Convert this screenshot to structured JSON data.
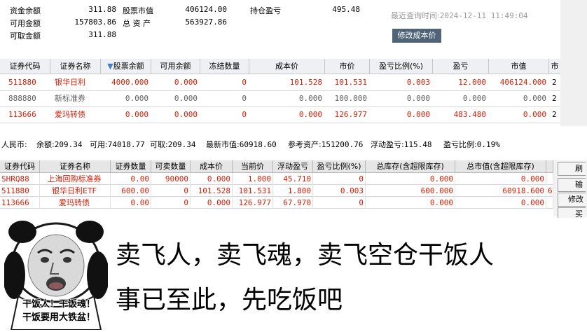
{
  "summary": {
    "fund_balance_label": "资金余额",
    "fund_balance": "311.88",
    "available_label": "可用金额",
    "available": "157803.86",
    "withdrawable_label": "可取金额",
    "withdrawable": "311.88",
    "stock_value_label": "股票市值",
    "stock_value": "406124.00",
    "total_assets_label": "总 资 产",
    "total_assets": "563927.86",
    "position_pl_label": "持仓盈亏",
    "position_pl": "495.48",
    "query_time_label": "最近查询时间:",
    "query_time": "2024-12-11 11:49:04",
    "modify_cost_button": "修改成本价"
  },
  "upper_table": {
    "sort_arrow": "▼",
    "headers": [
      "证券代码",
      "证券名称",
      "股票余额",
      "可用余额",
      "冻结数量",
      "成本价",
      "市价",
      "盈亏比例(%)",
      "盈亏",
      "市值",
      "市"
    ],
    "rows": [
      {
        "code": "511880",
        "name": "银华日利",
        "balance": "4000.000",
        "available": "0.000",
        "frozen": "0",
        "cost": "101.528",
        "price": "101.531",
        "pl_ratio": "0.003",
        "pl": "12.000",
        "value": "406124.000",
        "mkt": "2",
        "color": "red"
      },
      {
        "code": "888880",
        "name": "新标准券",
        "balance": "0.000",
        "available": "0.000",
        "frozen": "0",
        "cost": "0.000",
        "price": "100.000",
        "pl_ratio": "0.000",
        "pl": "0.000",
        "value": "0.000",
        "mkt": "2",
        "color": "gray"
      },
      {
        "code": "113666",
        "name": "爱玛转债",
        "balance": "0.000",
        "available": "0.000",
        "frozen": "0",
        "cost": "0.000",
        "price": "126.977",
        "pl_ratio": "0.000",
        "pl": "483.480",
        "value": "0.000",
        "mkt": "2",
        "color": "red"
      }
    ]
  },
  "rmb_bar": {
    "currency": "人民币:",
    "balance_label": "余额:",
    "balance": "209.34",
    "available_label": "可用:",
    "available": "74018.77",
    "withdrawable_label": "可取:",
    "withdrawable": "209.34",
    "latest_value_label": "最新市值:",
    "latest_value": "60918.60",
    "ref_assets_label": "参考资产:",
    "ref_assets": "151200.76",
    "floating_pl_label": "浮动盈亏:",
    "floating_pl": "115.48",
    "pl_ratio_label": "盈亏比例:",
    "pl_ratio": "0.19%"
  },
  "lower_table": {
    "headers": [
      "证券代码",
      "证券名称",
      "证券数量",
      "可卖数量",
      "成本价",
      "当前价",
      "浮动盈亏",
      "盈亏比例(%)",
      "总库存(含超限库存)",
      "总市值(含超限库存)"
    ],
    "rows": [
      {
        "code": "SHRQ88",
        "name": "上海回购标准券",
        "qty": "0.00",
        "sellable": "90000",
        "cost": "0.000",
        "price": "1.000",
        "float_pl": "45.710",
        "pl_ratio": "0",
        "stock": "0.000",
        "value": "0.000",
        "extra": ""
      },
      {
        "code": "511880",
        "name": "银华日利ETF",
        "qty": "600.00",
        "sellable": "0",
        "cost": "101.528",
        "price": "101.531",
        "float_pl": "1.800",
        "pl_ratio": "0.003",
        "stock": "600.000",
        "value": "60918.600",
        "extra": "6"
      },
      {
        "code": "113666",
        "name": "爱玛转债",
        "qty": "0.00",
        "sellable": "0",
        "cost": "0.000",
        "price": "126.977",
        "float_pl": "67.970",
        "pl_ratio": "0",
        "stock": "0.000",
        "value": "0.000",
        "extra": ""
      }
    ],
    "side_buttons": [
      "刷",
      "输",
      "修改",
      "买"
    ]
  },
  "meme": {
    "caption_1": "干饭人！干饭魂！",
    "caption_2": "干饭要用大铁盆！",
    "line_1": "卖飞人，卖飞魂，卖飞空仓干饭人",
    "line_2": "事已至此，先吃饭吧"
  }
}
